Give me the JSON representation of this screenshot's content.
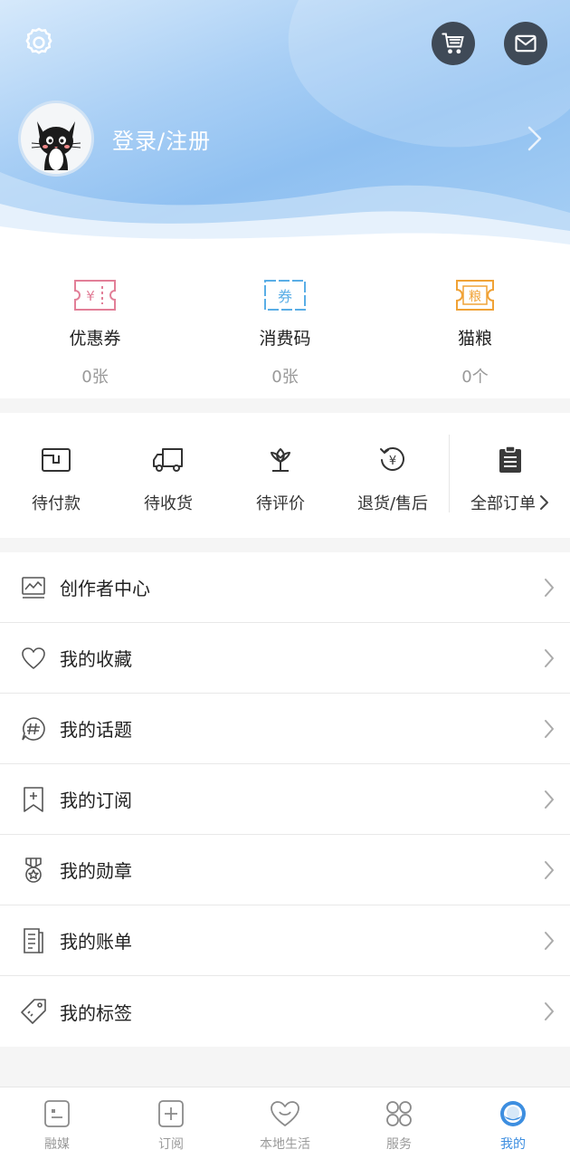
{
  "header": {
    "login_text": "登录/注册",
    "settings_icon": "gear-icon",
    "cart_icon": "cart-icon",
    "mail_icon": "mail-icon",
    "avatar": "cat-avatar"
  },
  "assets": [
    {
      "label": "优惠券",
      "value": "0张",
      "icon": "coupon-icon",
      "color": "#e27f98",
      "glyph": "¥"
    },
    {
      "label": "消费码",
      "value": "0张",
      "icon": "voucher-icon",
      "color": "#5aaee6",
      "glyph": "券"
    },
    {
      "label": "猫粮",
      "value": "0个",
      "icon": "catfood-icon",
      "color": "#f0a236",
      "glyph": "粮"
    }
  ],
  "orders": [
    {
      "label": "待付款",
      "icon": "wallet-icon"
    },
    {
      "label": "待收货",
      "icon": "truck-icon"
    },
    {
      "label": "待评价",
      "icon": "flower-icon"
    },
    {
      "label": "退货/售后",
      "icon": "refund-icon"
    }
  ],
  "orders_all": {
    "label": "全部订单",
    "icon": "clipboard-icon"
  },
  "menu": [
    {
      "label": "创作者中心",
      "icon": "chart-icon"
    },
    {
      "label": "我的收藏",
      "icon": "heart-icon"
    },
    {
      "label": "我的话题",
      "icon": "hashtag-icon"
    },
    {
      "label": "我的订阅",
      "icon": "bookmark-icon"
    },
    {
      "label": "我的勋章",
      "icon": "medal-icon"
    },
    {
      "label": "我的账单",
      "icon": "bill-icon"
    },
    {
      "label": "我的标签",
      "icon": "tag-icon"
    }
  ],
  "nav": [
    {
      "label": "融媒",
      "icon": "media-icon"
    },
    {
      "label": "订阅",
      "icon": "subscribe-icon"
    },
    {
      "label": "本地生活",
      "icon": "local-life-icon"
    },
    {
      "label": "服务",
      "icon": "services-icon"
    },
    {
      "label": "我的",
      "icon": "profile-icon"
    }
  ],
  "colors": {
    "accent": "#3d8ee0",
    "header_blue": "#8fc0f1",
    "icon_dark": "#3f4a57"
  }
}
